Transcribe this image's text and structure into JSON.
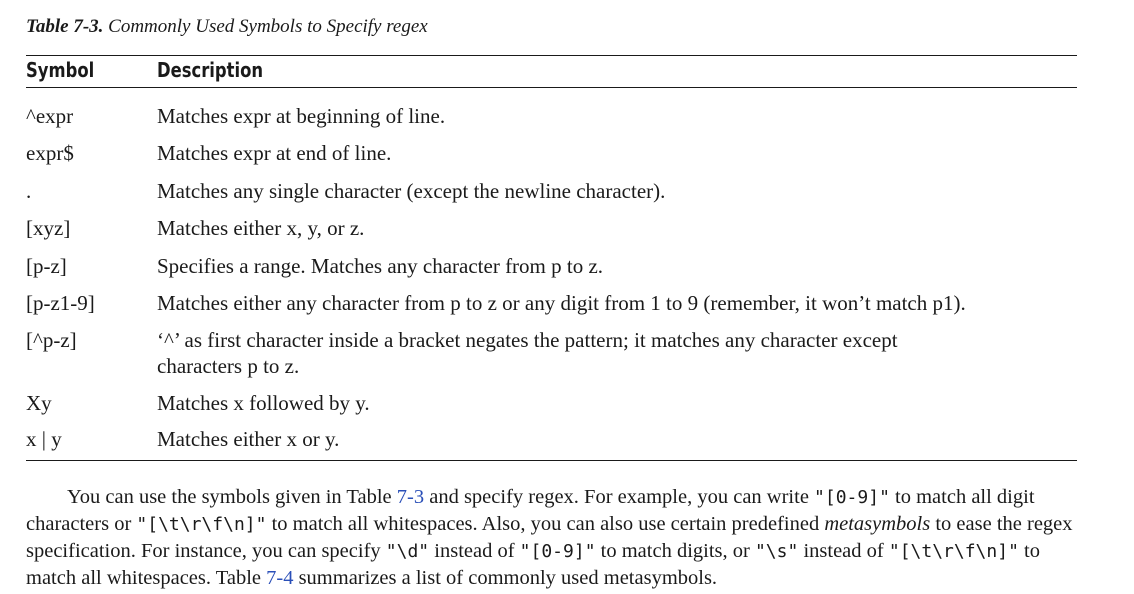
{
  "caption": {
    "label": "Table 7-3.",
    "title": "Commonly Used Symbols to Specify regex"
  },
  "table": {
    "headers": {
      "symbol": "Symbol",
      "description": "Description"
    },
    "rows": [
      {
        "symbol": "^expr",
        "description": "Matches expr at beginning of line."
      },
      {
        "symbol": "expr$",
        "description": "Matches expr at end of line."
      },
      {
        "symbol": ".",
        "description": "Matches any single character (except the newline character)."
      },
      {
        "symbol": "[xyz]",
        "description": "Matches either x, y, or z."
      },
      {
        "symbol": "[p-z]",
        "description": "Specifies a range. Matches any character from p to z."
      },
      {
        "symbol": "[p-z1-9]",
        "description": "Matches either any character from p to z or any digit from 1 to 9 (remember, it won’t match p1)."
      },
      {
        "symbol": "[^p-z]",
        "description": "‘^’ as first character inside a bracket negates the pattern; it matches any character except characters p to z."
      },
      {
        "symbol": "Xy",
        "description": "Matches x followed by y."
      },
      {
        "symbol": "x | y",
        "description": "Matches either x or y."
      }
    ]
  },
  "paragraph": {
    "t1": "You can use the symbols given in Table ",
    "ref1": "7-3",
    "t2": " and specify regex. For example, you can write ",
    "c1": "\"[0-9]\"",
    "t3": " to match all digit characters or ",
    "c2": "\"[\\t\\r\\f\\n]\"",
    "t4": " to match all whitespaces. Also, you can also use certain predefined ",
    "em1": "metasymbols",
    "t5": " to ease the regex specification. For instance, you can specify ",
    "c3": "\"\\d\"",
    "t6": " instead of ",
    "c4": "\"[0-9]\"",
    "t7": " to match digits, or ",
    "c5": "\"\\s\"",
    "t8": " instead of ",
    "c6": "\"[\\t\\r\\f\\n]\"",
    "t9": " to match all whitespaces. Table ",
    "ref2": "7-4",
    "t10": " summarizes a list of commonly used metasymbols."
  }
}
